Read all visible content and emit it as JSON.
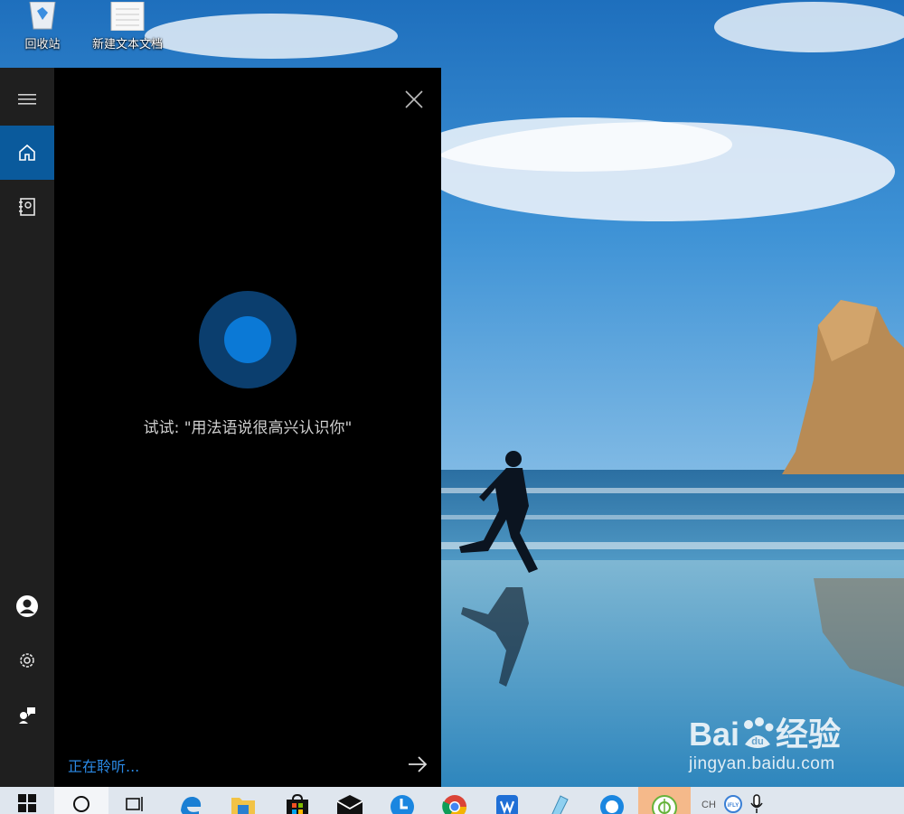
{
  "desktop": {
    "icons": [
      {
        "label": "回收站",
        "icon": "recycle-bin-icon"
      },
      {
        "label": "新建文本文档",
        "icon": "text-document-icon"
      }
    ]
  },
  "cortana": {
    "rail": {
      "menu": "hamburger-icon",
      "home": "home-icon",
      "notebook": "notebook-icon",
      "account": "user-icon",
      "settings": "gear-icon",
      "feedback": "feedback-icon"
    },
    "close": "close-icon",
    "suggestion": "试试: \"用法语说很高兴认识你\"",
    "listening_status": "正在聆听...",
    "submit": "arrow-right-icon",
    "colors": {
      "accent": "#0a5a9c",
      "orb_outer": "#0b3e6e",
      "orb_inner": "#0b79d6",
      "status_text": "#2b8ae6"
    }
  },
  "watermark": {
    "brand": "Bai",
    "brand_suffix": "经验",
    "url": "jingyan.baidu.com"
  },
  "taskbar": {
    "items": [
      "windows-start-icon",
      "search-icon",
      "task-view-icon",
      "edge-icon",
      "file-explorer-icon",
      "store-icon",
      "mail-icon",
      "clock-app-icon",
      "chrome-icon",
      "wps-icon",
      "notepad-icon",
      "cortana-icon",
      "green-app-icon"
    ],
    "ime_label": "CH",
    "tray": [
      "ifly-icon",
      "microphone-icon"
    ]
  }
}
